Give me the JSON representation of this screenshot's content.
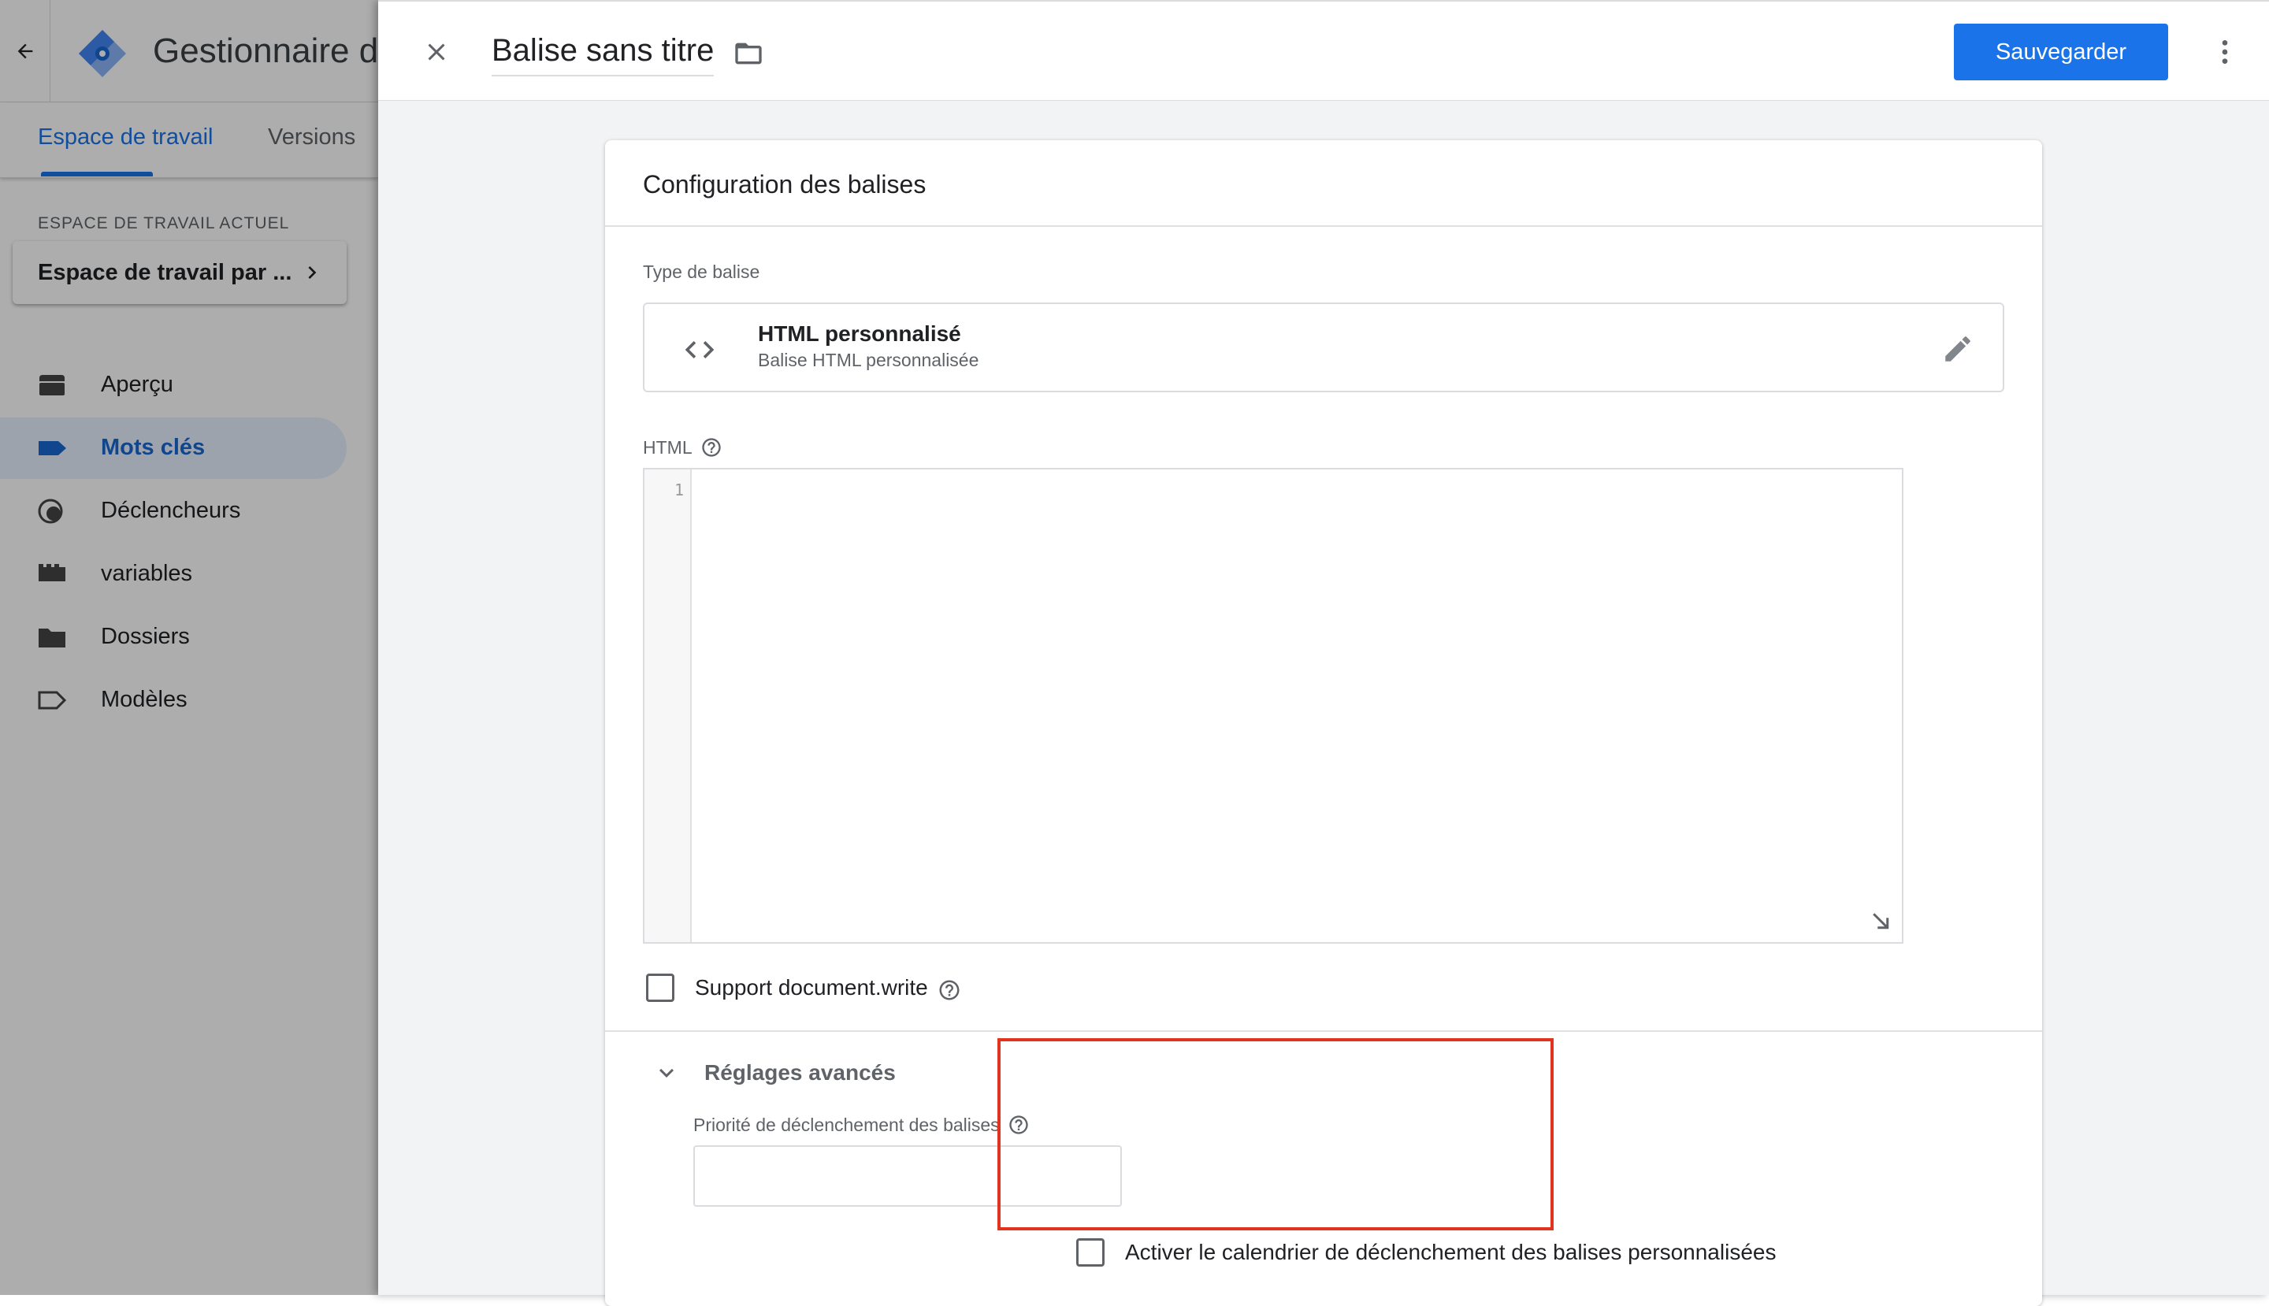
{
  "app": {
    "title": "Gestionnaire de balises"
  },
  "left_tabs": [
    {
      "label": "Espace de travail",
      "active": true
    },
    {
      "label": "Versions",
      "active": false
    }
  ],
  "workspace": {
    "section_label": "ESPACE DE TRAVAIL ACTUEL",
    "current": "Espace de travail par ..."
  },
  "nav": [
    {
      "label": "Aperçu",
      "icon": "overview-icon",
      "active": false
    },
    {
      "label": "Mots clés",
      "icon": "tag-icon",
      "active": true
    },
    {
      "label": "Déclencheurs",
      "icon": "trigger-icon",
      "active": false
    },
    {
      "label": "variables",
      "icon": "variables-icon",
      "active": false
    },
    {
      "label": "Dossiers",
      "icon": "folder-icon",
      "active": false
    },
    {
      "label": "Modèles",
      "icon": "template-icon",
      "active": false
    }
  ],
  "topbar": {
    "tag_name": "Balise sans titre",
    "save_label": "Sauvegarder"
  },
  "card": {
    "title": "Configuration des balises",
    "type_label": "Type de balise",
    "type_name": "HTML personnalisé",
    "type_desc": "Balise HTML personnalisée",
    "html_label": "HTML",
    "line_number": "1",
    "docwrite_label": "Support document.write",
    "docwrite_checked": false,
    "advanced_title": "Réglages avancés",
    "priority_label": "Priorité de déclenchement des balises",
    "priority_value": "",
    "schedule_label": "Activer le calendrier de déclenchement des balises personnalisées",
    "schedule_checked": false
  },
  "colors": {
    "accent": "#1a73e8",
    "highlight": "#e0341e",
    "active_nav_bg": "#e8f0fe"
  }
}
